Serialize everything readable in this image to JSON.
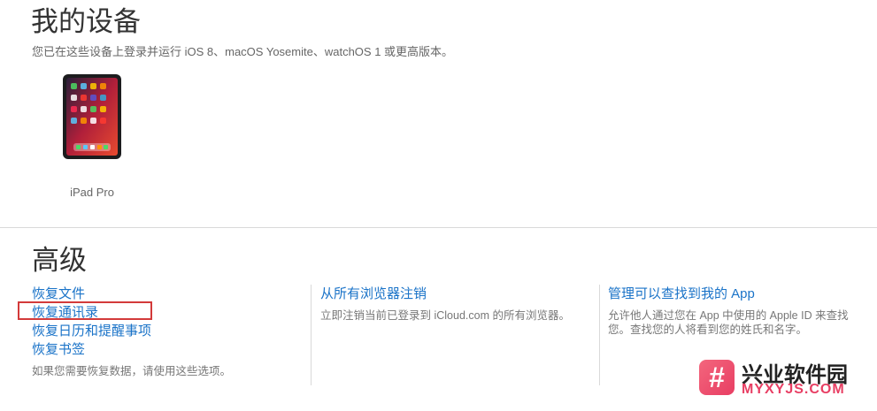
{
  "devices": {
    "title": "我的设备",
    "subtitle": "您已在这些设备上登录并运行 iOS 8、macOS Yosemite、watchOS 1 或更高版本。",
    "items": [
      {
        "label": "iPad Pro"
      }
    ]
  },
  "advanced": {
    "title": "高级",
    "columns": [
      {
        "links": [
          "恢复文件",
          "恢复通讯录",
          "恢复日历和提醒事项",
          "恢复书签"
        ],
        "description": "如果您需要恢复数据，请使用这些选项。"
      },
      {
        "links": [
          "从所有浏览器注销"
        ],
        "description": "立即注销当前已登录到 iCloud.com 的所有浏览器。"
      },
      {
        "links": [
          "管理可以查找到我的 App"
        ],
        "description": "允许他人通过您在 App 中使用的 Apple ID 来查找您。查找您的人将看到您的姓氏和名字。"
      }
    ]
  },
  "watermark": {
    "cn": "兴业软件园",
    "en": "MYXYJS.COM",
    "logo_glyph": "#"
  },
  "colors": {
    "link": "#1a73c8",
    "highlight": "#d33a3a",
    "watermark_accent": "#e83e63"
  }
}
